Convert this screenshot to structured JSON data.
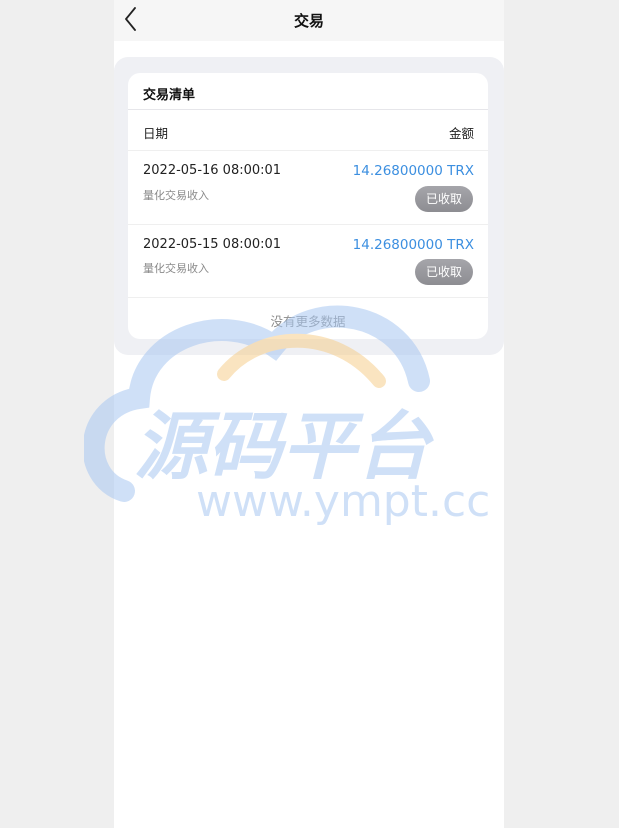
{
  "header": {
    "title": "交易",
    "back_icon": "chevron-left-icon"
  },
  "list": {
    "title": "交易清单",
    "col_date": "日期",
    "col_amount": "金额",
    "rows": [
      {
        "date": "2022-05-16 08:00:01",
        "desc": "量化交易收入",
        "amount": "14.26800000 TRX",
        "status": "已收取"
      },
      {
        "date": "2022-05-15 08:00:01",
        "desc": "量化交易收入",
        "amount": "14.26800000 TRX",
        "status": "已收取"
      }
    ],
    "no_more": "没有更多数据"
  },
  "watermark": {
    "title": "源码平台",
    "url": "www.ympt.cc"
  },
  "colors": {
    "amount": "#3c8fe0",
    "status_bg": "#9b9b9f",
    "card_bg": "#eff0f4",
    "header_bg": "#f6f6f6",
    "watermark_blue": "#a9c8f2",
    "watermark_orange": "#f6cf8e"
  }
}
